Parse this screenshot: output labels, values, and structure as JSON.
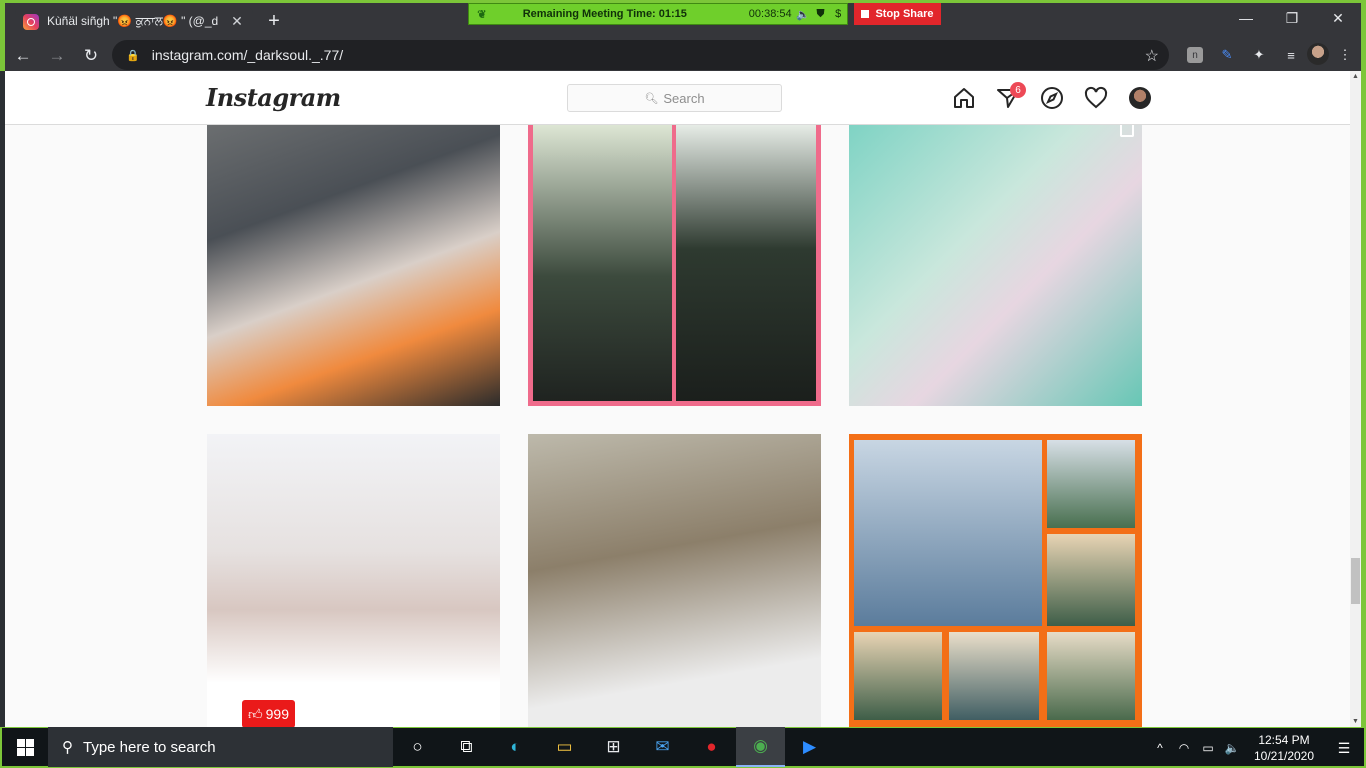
{
  "browser": {
    "tab_title": "Kùñäl siñgh \"😡 ਕੁਨਾਲ😡 \" (@_d",
    "tab_close": "✕",
    "new_tab": "+",
    "url": "instagram.com/_darksoul._.77/"
  },
  "meeting": {
    "remaining_label": "Remaining Meeting Time: 01:15",
    "elapsed": "00:38:54",
    "stop_share_label": "Stop Share"
  },
  "instagram": {
    "logo_text": "Instagram",
    "search_placeholder": "Search",
    "activity_badge_count": "6"
  },
  "posts": [
    {
      "description": "three friends selfie in orange uniforms",
      "colors": [
        "#4a4f55",
        "#f08a3e",
        "#d9cfc8"
      ]
    },
    {
      "description": "two-panel collage with pink border",
      "colors": [
        "#ef6b8b",
        "#3c4a3d",
        "#dde6d4"
      ]
    },
    {
      "description": "friends covered in holi colors",
      "colors": [
        "#7fd3c4",
        "#c9e7dc",
        "#e7d6e1"
      ]
    },
    {
      "description": "selfie with pikachu sticker",
      "colors": [
        "#f2f3f6",
        "#d8c7c1",
        "#ffffff"
      ],
      "like_count": "999"
    },
    {
      "description": "close-up selfie with glasses",
      "colors": [
        "#bdb9ab",
        "#8c7f6a",
        "#ececec"
      ]
    },
    {
      "description": "orange-framed group collage with bicycles",
      "colors": [
        "#f36f17",
        "#5b7c9c",
        "#e8d4b4"
      ]
    }
  ],
  "taskbar": {
    "search_placeholder": "Type here to search",
    "time": "12:54 PM",
    "date": "10/21/2020"
  }
}
